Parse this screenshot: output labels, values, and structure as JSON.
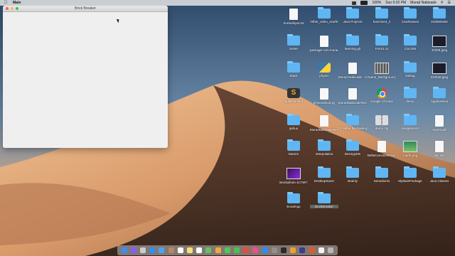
{
  "menubar": {
    "app_name": "Main",
    "battery": "100%",
    "clock": "Sun 6:02 PM",
    "user": "Murad Nabizade"
  },
  "window": {
    "title": "Brick Breaker"
  },
  "desktop": {
    "items": [
      {
        "label": "SortedInput.txt",
        "type": "doc"
      },
      {
        "label": "Other_video_scarfe",
        "type": "folder"
      },
      {
        "label": "Java Projects",
        "type": "folder"
      },
      {
        "label": "Exercise4_2",
        "type": "folder"
      },
      {
        "label": "CardGames",
        "type": "folder"
      },
      {
        "label": "2ndWebsite",
        "type": "folder"
      },
      {
        "label": "Sorter",
        "type": "folder"
      },
      {
        "label": "package com.muradn..",
        "type": "doc"
      },
      {
        "label": "learning-git",
        "type": "folder"
      },
      {
        "label": "Form1.cs",
        "type": "folder"
      },
      {
        "label": "CSc205",
        "type": "folder"
      },
      {
        "label": "34328.jpeg",
        "type": "img-dark"
      },
      {
        "label": "Stack",
        "type": "folder"
      },
      {
        "label": "phyton",
        "type": "python"
      },
      {
        "label": "Murad Nabizade - Cover letter.docx",
        "type": "doc"
      },
      {
        "label": "Game_Background_110.jpeg",
        "type": "img-grid"
      },
      {
        "label": "Debug",
        "type": "folder"
      },
      {
        "label": "334549.jpeg",
        "type": "img-dark"
      },
      {
        "label": "Sublime Text",
        "type": "sublime"
      },
      {
        "label": "phytondmod.py",
        "type": "doc"
      },
      {
        "label": "MuradNabizadeResume.DOCX",
        "type": "doc"
      },
      {
        "label": "Google Chrome",
        "type": "chrome"
      },
      {
        "label": "demo",
        "type": "folder"
      },
      {
        "label": "Applications",
        "type": "folder"
      },
      {
        "label": "qahuu",
        "type": "folder"
      },
      {
        "label": "MuradNabizadeResume.pdf",
        "type": "doc"
      },
      {
        "label": "I'd rather be Painting...Etsy_files",
        "type": "folder"
      },
      {
        "label": "demo.zip",
        "type": "zip"
      },
      {
        "label": "Assignment4",
        "type": "folder"
      },
      {
        "label": "report.pdf",
        "type": "doc"
      },
      {
        "label": "Musics",
        "type": "folder"
      },
      {
        "label": "Interpolation",
        "type": "folder"
      },
      {
        "label": "DesingsHE",
        "type": "folder"
      },
      {
        "label": "BellaCanvas3001SizeChart...py 2.jpg",
        "type": "doc"
      },
      {
        "label": "road3.png",
        "type": "img-green"
      },
      {
        "label": "My sol",
        "type": "doc"
      },
      {
        "label": "istockphoto-1174871534-6...612.jpeg",
        "type": "img-purple"
      },
      {
        "label": "DesktopSaver",
        "type": "folder"
      },
      {
        "label": "Brainly",
        "type": "folder"
      },
      {
        "label": "Senediorim",
        "type": "folder"
      },
      {
        "label": "MyMainPackage",
        "type": "folder"
      },
      {
        "label": "Java Classes",
        "type": "folder"
      },
      {
        "label": "EmailApp",
        "type": "folder"
      },
      {
        "label": "BrickBreaker",
        "type": "folder",
        "selected": true
      }
    ]
  },
  "dock": {
    "apps": [
      "finder",
      "siri",
      "launchpad",
      "safari",
      "mail",
      "contacts",
      "calendar",
      "notes",
      "reminders",
      "maps",
      "photos",
      "messages",
      "facetime",
      "chrome",
      "itunes",
      "appstore",
      "preferences",
      "terminal",
      "sublime",
      "eclipse",
      "java",
      "document",
      "trash"
    ],
    "colors": [
      "#3b8ef0",
      "#8a5cf6",
      "#cccccc",
      "#2f8ef5",
      "#4aa3f7",
      "#b58a63",
      "#ffffff",
      "#f6e27a",
      "#ffffff",
      "#63c06a",
      "#f3a73c",
      "#50c75a",
      "#49c057",
      "#e94b3c",
      "#ef4f8b",
      "#2b8ef7",
      "#8f8f8f",
      "#2b2b2b",
      "#f0a02a",
      "#3b3b8f",
      "#e05a2b",
      "#f3f3f3",
      "#b7b7b7"
    ]
  }
}
